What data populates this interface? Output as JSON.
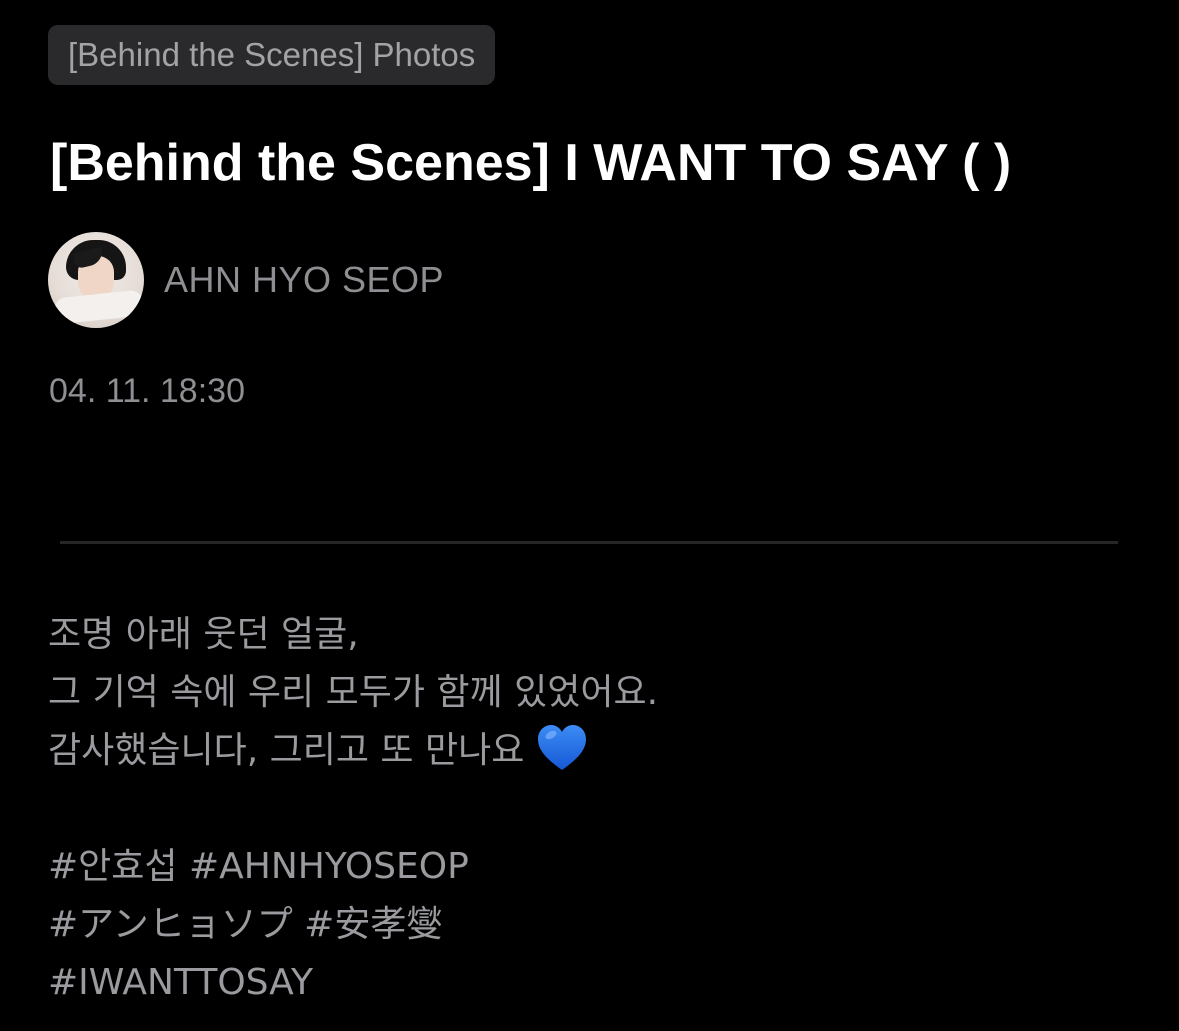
{
  "post": {
    "category": "[Behind the Scenes] Photos",
    "title": "[Behind the Scenes] I WANT TO SAY (   )",
    "author": "AHN HYO SEOP",
    "timestamp": "04. 11. 18:30"
  },
  "body": {
    "lines": [
      "조명 아래 웃던 얼굴,",
      "그 기억 속에 우리 모두가 함께 있었어요.",
      "감사했습니다, 그리고 또 만나요"
    ],
    "heart_icon": "blue-heart-icon",
    "heart_color": "#1f6fe0",
    "hashtags": [
      "#안효섭 #AHNHYOSEOP",
      "#アンヒョソプ #安孝燮",
      "#IWANTTOSAY"
    ]
  },
  "colors": {
    "background": "#000000",
    "chip_background": "#2a2a2c",
    "secondary_text": "#8e8e93"
  }
}
